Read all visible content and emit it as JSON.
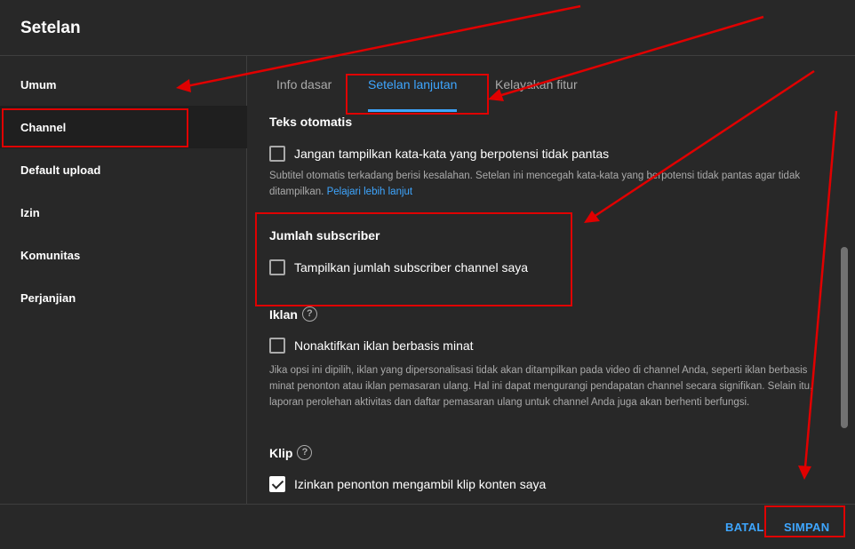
{
  "header": {
    "title": "Setelan"
  },
  "sidebar": {
    "items": [
      {
        "label": "Umum"
      },
      {
        "label": "Channel",
        "active": true
      },
      {
        "label": "Default upload"
      },
      {
        "label": "Izin"
      },
      {
        "label": "Komunitas"
      },
      {
        "label": "Perjanjian"
      }
    ]
  },
  "tabs": [
    {
      "label": "Info dasar"
    },
    {
      "label": "Setelan lanjutan",
      "active": true
    },
    {
      "label": "Kelayakan fitur"
    }
  ],
  "sections": {
    "teks_otomatis": {
      "title": "Teks otomatis",
      "checkbox_label": "Jangan tampilkan kata-kata yang berpotensi tidak pantas",
      "checked": false,
      "description": "Subtitel otomatis terkadang berisi kesalahan. Setelan ini mencegah kata-kata yang berpotensi tidak pantas agar tidak ditampilkan.",
      "link": "Pelajari lebih lanjut"
    },
    "jumlah_subscriber": {
      "title": "Jumlah subscriber",
      "checkbox_label": "Tampilkan jumlah subscriber channel saya",
      "checked": false
    },
    "iklan": {
      "title": "Iklan",
      "checkbox_label": "Nonaktifkan iklan berbasis minat",
      "checked": false,
      "description": "Jika opsi ini dipilih, iklan yang dipersonalisasi tidak akan ditampilkan pada video di channel Anda, seperti iklan berbasis minat penonton atau iklan pemasaran ulang. Hal ini dapat mengurangi pendapatan channel secara signifikan. Selain itu, laporan perolehan aktivitas dan daftar pemasaran ulang untuk channel Anda juga akan berhenti berfungsi."
    },
    "klip": {
      "title": "Klip",
      "checkbox_label": "Izinkan penonton mengambil klip konten saya",
      "checked": true
    }
  },
  "help_icon": {
    "glyph": "?"
  },
  "footer": {
    "cancel_label": "BATAL",
    "save_label": "SIMPAN"
  },
  "colors": {
    "accent": "#3ea6ff",
    "annotation": "#e00000",
    "background": "#282828"
  }
}
